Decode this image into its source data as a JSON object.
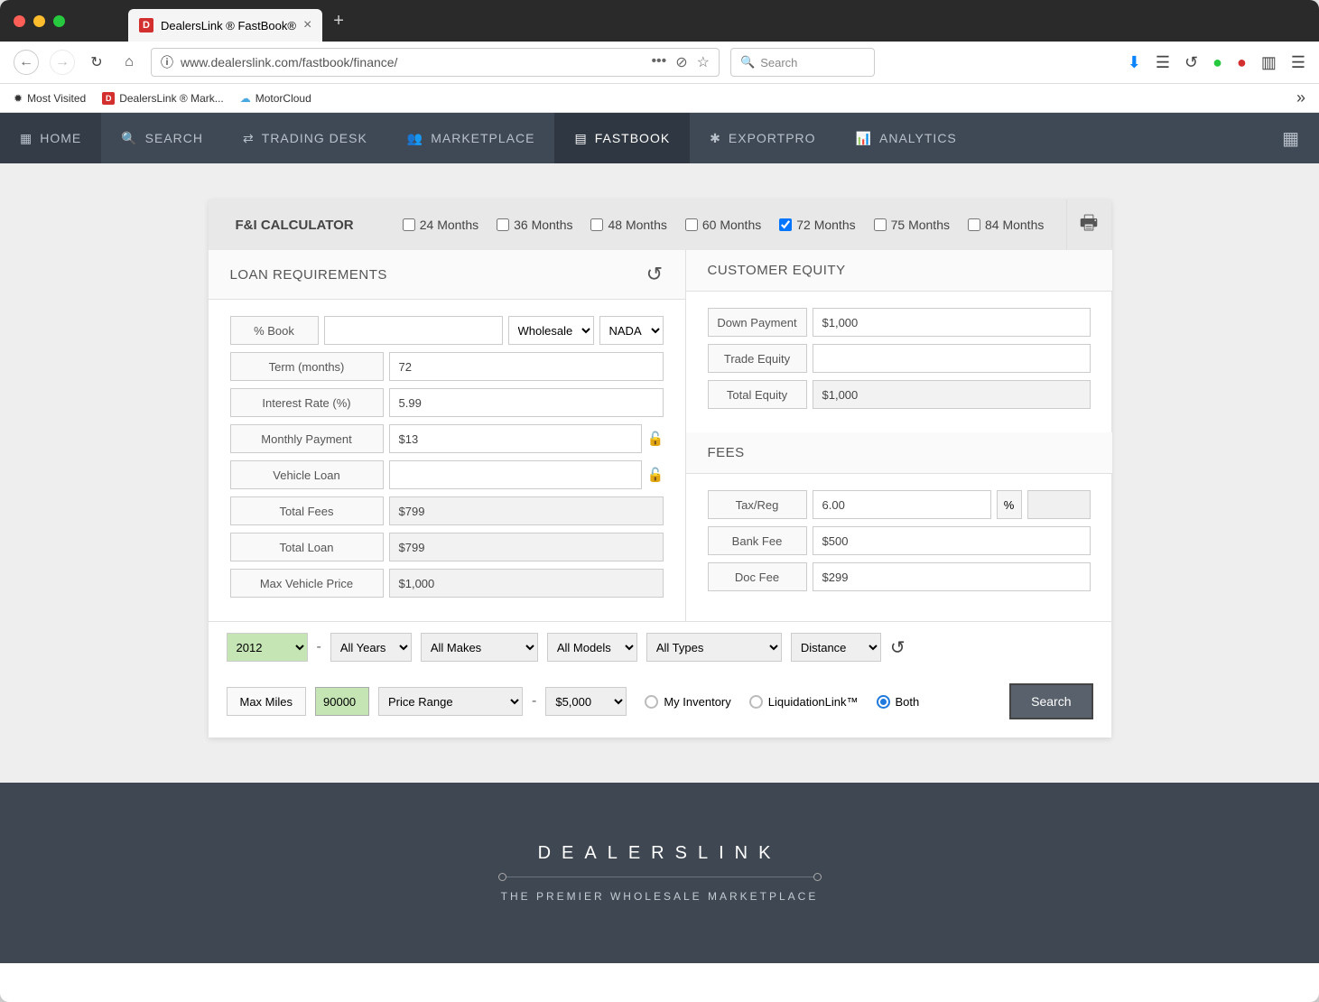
{
  "browser": {
    "tab_title": "DealersLink ® FastBook®",
    "url": "www.dealerslink.com/fastbook/finance/",
    "search_placeholder": "Search",
    "bookmarks": [
      "Most Visited",
      "DealersLink ® Mark...",
      "MotorCloud"
    ]
  },
  "nav": {
    "items": [
      "HOME",
      "SEARCH",
      "TRADING DESK",
      "MARKETPLACE",
      "FASTBOOK",
      "EXPORTPRO",
      "ANALYTICS"
    ]
  },
  "calc": {
    "title": "F&I CALCULATOR",
    "months": [
      "24 Months",
      "36 Months",
      "48 Months",
      "60 Months",
      "72 Months",
      "75 Months",
      "84 Months"
    ],
    "months_checked": 4
  },
  "loan": {
    "header": "LOAN REQUIREMENTS",
    "pct_book_label": "% Book",
    "pct_book_value": "",
    "wholesale": "Wholesale",
    "source": "NADA",
    "term_label": "Term (months)",
    "term_value": "72",
    "rate_label": "Interest Rate (%)",
    "rate_value": "5.99",
    "monthly_label": "Monthly Payment",
    "monthly_value": "$13",
    "vehicle_loan_label": "Vehicle Loan",
    "vehicle_loan_value": "",
    "total_fees_label": "Total Fees",
    "total_fees_value": "$799",
    "total_loan_label": "Total Loan",
    "total_loan_value": "$799",
    "max_price_label": "Max Vehicle Price",
    "max_price_value": "$1,000"
  },
  "equity": {
    "header": "CUSTOMER EQUITY",
    "down_label": "Down Payment",
    "down_value": "$1,000",
    "trade_label": "Trade Equity",
    "trade_value": "",
    "total_label": "Total Equity",
    "total_value": "$1,000"
  },
  "fees": {
    "header": "FEES",
    "tax_label": "Tax/Reg",
    "tax_value": "6.00",
    "pct": "%",
    "bank_label": "Bank Fee",
    "bank_value": "$500",
    "doc_label": "Doc Fee",
    "doc_value": "$299"
  },
  "filters": {
    "year_from": "2012",
    "year_to": "All Years",
    "makes": "All Makes",
    "models": "All Models",
    "types": "All Types",
    "distance": "Distance",
    "max_miles_label": "Max Miles",
    "max_miles_value": "90000",
    "price_range": "Price Range",
    "price_to": "$5,000",
    "radio_inventory": "My Inventory",
    "radio_liquidation": "LiquidationLink™",
    "radio_both": "Both",
    "search_btn": "Search"
  },
  "footer": {
    "logo": "DEALERSLINK",
    "tagline": "THE PREMIER WHOLESALE MARKETPLACE"
  }
}
